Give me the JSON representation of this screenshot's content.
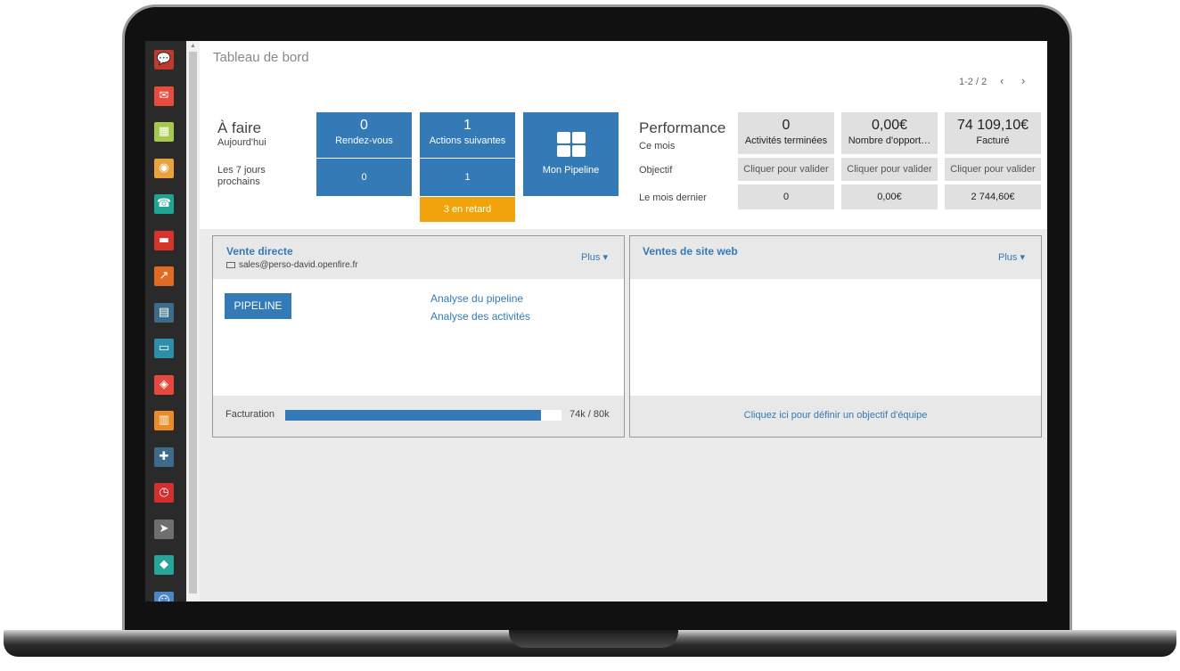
{
  "colors": {
    "primary": "#337ab7",
    "warning": "#f0a30a",
    "sidebar": "#2a2a2a"
  },
  "sidebar_icons": [
    {
      "name": "discuss-icon",
      "color": "#c0392b",
      "glyph": "💬"
    },
    {
      "name": "mail-icon",
      "color": "#e74c3c",
      "glyph": "✉"
    },
    {
      "name": "calendar-icon",
      "color": "#a5c94f",
      "glyph": "▦"
    },
    {
      "name": "crm-icon",
      "color": "#e8a33c",
      "glyph": "◉"
    },
    {
      "name": "contacts-icon",
      "color": "#1fa393",
      "glyph": "☎"
    },
    {
      "name": "folder-icon",
      "color": "#d9342b",
      "glyph": "▬"
    },
    {
      "name": "sales-chart-icon",
      "color": "#e06c23",
      "glyph": "↗"
    },
    {
      "name": "calculator-icon",
      "color": "#3d6c8a",
      "glyph": "▤"
    },
    {
      "name": "card-icon",
      "color": "#2f8fa8",
      "glyph": "▭"
    },
    {
      "name": "inventory-icon",
      "color": "#e64a3c",
      "glyph": "◈"
    },
    {
      "name": "invoice-icon",
      "color": "#f08b23",
      "glyph": "▥"
    },
    {
      "name": "puzzle-icon",
      "color": "#3d6c8a",
      "glyph": "✚"
    },
    {
      "name": "clock-icon",
      "color": "#d32f2f",
      "glyph": "◷"
    },
    {
      "name": "send-icon",
      "color": "#6f6f6f",
      "glyph": "➤"
    },
    {
      "name": "tag-icon",
      "color": "#26a69a",
      "glyph": "◆"
    },
    {
      "name": "team-icon",
      "color": "#4a86c8",
      "glyph": "☺"
    }
  ],
  "header": {
    "title": "Tableau de bord",
    "pager": "1-2 / 2"
  },
  "todo": {
    "title": "À faire",
    "today_label": "Aujourd'hui",
    "next7_label": "Les 7 jours prochains",
    "rdv": {
      "count_today": "0",
      "label": "Rendez-vous",
      "count_7d": "0"
    },
    "actions": {
      "count_today": "1",
      "label": "Actions suivantes",
      "count_7d": "1",
      "late": "3 en retard"
    },
    "pipeline_label": "Mon Pipeline"
  },
  "performance": {
    "title": "Performance",
    "row_labels": [
      "Ce mois",
      "Objectif",
      "Le mois dernier"
    ],
    "columns": [
      {
        "value": "0",
        "label": "Activités terminées",
        "objective": "Cliquer pour valider",
        "last": "0"
      },
      {
        "value": "0,00€",
        "label": "Nombre d'opport…",
        "objective": "Cliquer pour valider",
        "last": "0,00€"
      },
      {
        "value": "74 109,10€",
        "label": "Facturé",
        "objective": "Cliquer pour valider",
        "last": "2 744,60€"
      }
    ]
  },
  "teams": [
    {
      "title": "Vente directe",
      "email": "sales@perso-david.openfire.fr",
      "more": "Plus ▾",
      "button": "PIPELINE",
      "links": [
        "Analyse du pipeline",
        "Analyse des activités"
      ],
      "invoicing_label": "Facturation",
      "invoicing_text": "74k / 80k",
      "invoicing_progress": 0.926
    },
    {
      "title": "Ventes de site web",
      "more": "Plus ▾",
      "footer_link": "Cliquez ici pour définir un objectif d'équipe"
    }
  ]
}
